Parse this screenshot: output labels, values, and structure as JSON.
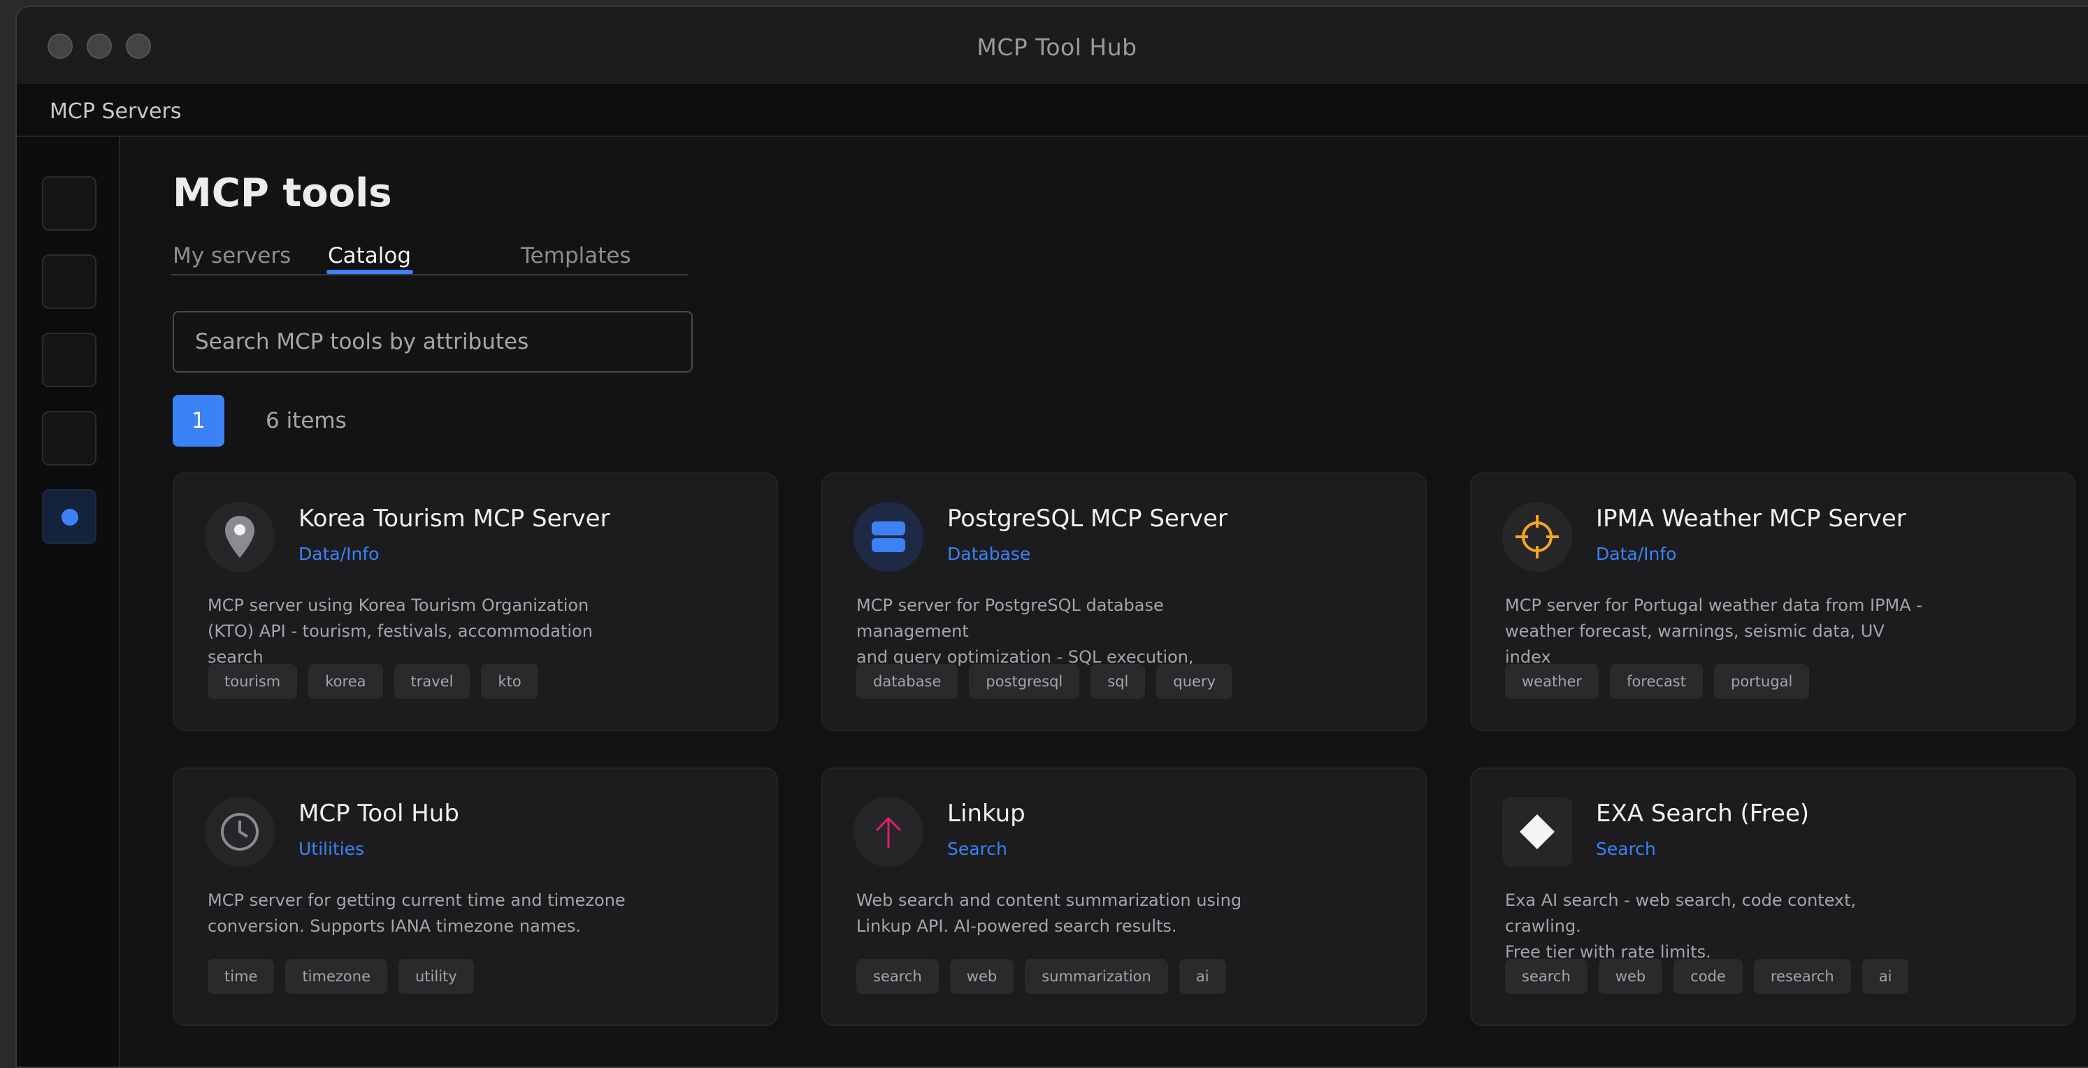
{
  "window": {
    "title": "MCP Tool Hub"
  },
  "navbar": {
    "title": "MCP Servers"
  },
  "page": {
    "heading": "MCP tools"
  },
  "tabs": [
    {
      "label": "My servers"
    },
    {
      "label": "Catalog"
    },
    {
      "label": "Templates"
    }
  ],
  "active_tab": "Catalog",
  "search": {
    "placeholder": "Search MCP tools by attributes"
  },
  "pagination": {
    "current_page": "1",
    "count_label": "6 items"
  },
  "accent_color": "#3b82f6",
  "cards": [
    {
      "title": "Korea Tourism MCP Server",
      "category": "Data/Info",
      "desc1": "MCP server using Korea Tourism Organization",
      "desc2": "(KTO) API - tourism, festivals, accommodation search",
      "icon": "map-pin-icon",
      "tags": [
        "tourism",
        "korea",
        "travel",
        "kto"
      ]
    },
    {
      "title": "PostgreSQL MCP Server",
      "category": "Database",
      "desc1": "MCP server for PostgreSQL database management",
      "desc2": "and query optimization - SQL execution, monitoring",
      "icon": "database-icon",
      "tags": [
        "database",
        "postgresql",
        "sql",
        "query"
      ]
    },
    {
      "title": "IPMA Weather MCP Server",
      "category": "Data/Info",
      "desc1": "MCP server for Portugal weather data from IPMA -",
      "desc2": "weather forecast, warnings, seismic data, UV index",
      "icon": "crosshair-icon",
      "tags": [
        "weather",
        "forecast",
        "portugal"
      ]
    },
    {
      "title": "MCP Tool Hub",
      "category": "Utilities",
      "desc1": "MCP server for getting current time and timezone",
      "desc2": "conversion. Supports IANA timezone names.",
      "icon": "clock-icon",
      "tags": [
        "time",
        "timezone",
        "utility"
      ]
    },
    {
      "title": "Linkup",
      "category": "Search",
      "desc1": "Web search and content summarization using",
      "desc2": "Linkup API. AI-powered search results.",
      "icon": "arrow-up-icon",
      "tags": [
        "search",
        "web",
        "summarization",
        "ai"
      ]
    },
    {
      "title": "EXA Search (Free)",
      "category": "Search",
      "desc1": "Exa AI search - web search, code context, crawling.",
      "desc2": "Free tier with rate limits.",
      "icon": "diamond-icon",
      "tags": [
        "search",
        "web",
        "code",
        "research",
        "ai"
      ]
    }
  ]
}
